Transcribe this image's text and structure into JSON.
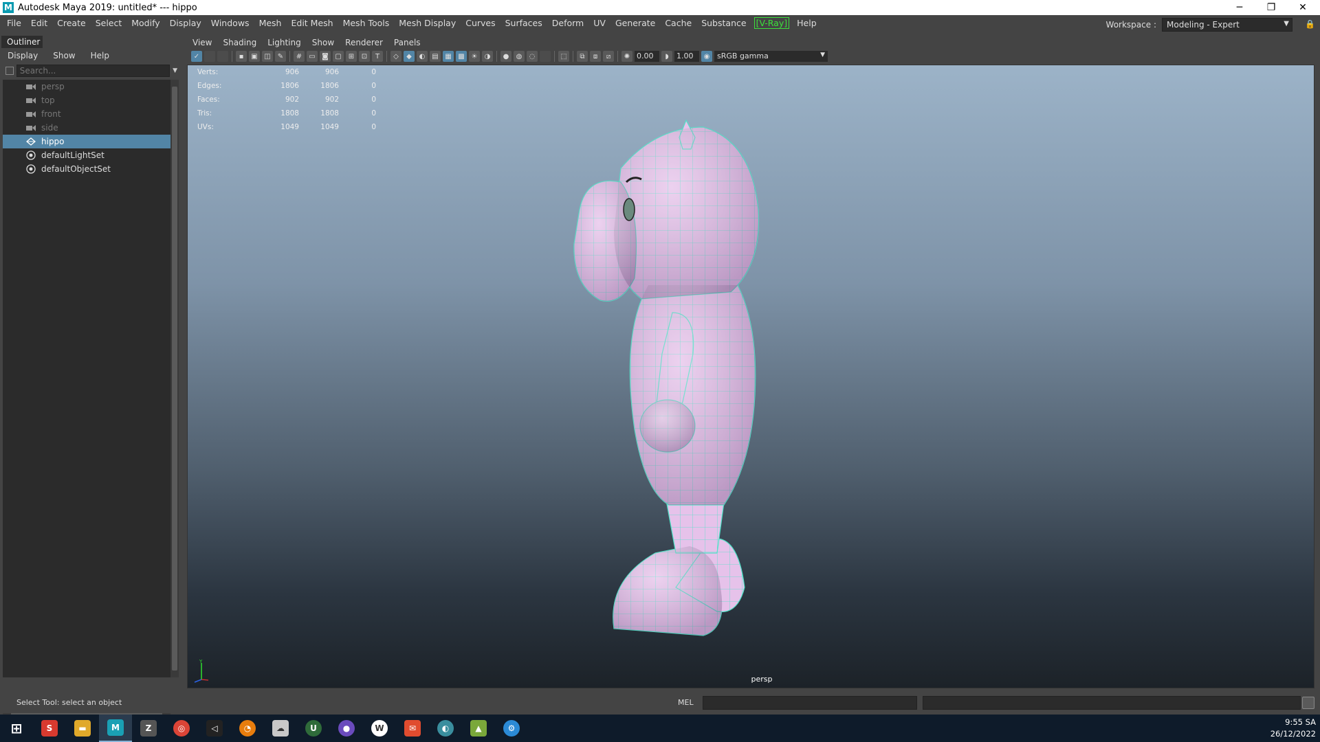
{
  "window": {
    "title": "Autodesk Maya 2019: untitled*   ---   hippo",
    "logo_letter": "M",
    "minimize": "─",
    "restore": "❐",
    "close": "✕"
  },
  "menubar": {
    "items": [
      "File",
      "Edit",
      "Create",
      "Select",
      "Modify",
      "Display",
      "Windows",
      "Mesh",
      "Edit Mesh",
      "Mesh Tools",
      "Mesh Display",
      "Curves",
      "Surfaces",
      "Deform",
      "UV",
      "Generate",
      "Cache",
      "Substance",
      "[V-Ray]",
      "Help"
    ],
    "workspace_label": "Workspace :",
    "workspace_value": "Modeling - Expert"
  },
  "outliner": {
    "tab": "Outliner",
    "menu": [
      "Display",
      "Show",
      "Help"
    ],
    "search_placeholder": "Search...",
    "items": [
      {
        "label": "persp",
        "icon": "camera-icon",
        "type": "camera"
      },
      {
        "label": "top",
        "icon": "camera-icon",
        "type": "camera"
      },
      {
        "label": "front",
        "icon": "camera-icon",
        "type": "camera"
      },
      {
        "label": "side",
        "icon": "camera-icon",
        "type": "camera"
      },
      {
        "label": "hippo",
        "icon": "mesh-icon",
        "type": "mesh",
        "selected": true
      },
      {
        "label": "defaultLightSet",
        "icon": "set-icon",
        "type": "set"
      },
      {
        "label": "defaultObjectSet",
        "icon": "set-icon",
        "type": "set"
      }
    ]
  },
  "viewport": {
    "menu": [
      "View",
      "Shading",
      "Lighting",
      "Show",
      "Renderer",
      "Panels"
    ],
    "exposure": "0.00",
    "gamma": "1.00",
    "color_space": "sRGB gamma",
    "camera": "persp",
    "hud": [
      {
        "label": "Verts:",
        "v1": "906",
        "v2": "906",
        "v3": "0"
      },
      {
        "label": "Edges:",
        "v1": "1806",
        "v2": "1806",
        "v3": "0"
      },
      {
        "label": "Faces:",
        "v1": "902",
        "v2": "902",
        "v3": "0"
      },
      {
        "label": "Tris:",
        "v1": "1808",
        "v2": "1808",
        "v3": "0"
      },
      {
        "label": "UVs:",
        "v1": "1049",
        "v2": "1049",
        "v3": "0"
      }
    ],
    "model_colors": {
      "surface": "#e8c4ec",
      "wire": "#4fe3c8"
    }
  },
  "status": {
    "help_line": "Select Tool: select an object",
    "mel_label": "MEL"
  },
  "taskbar": {
    "time": "9:55 SA",
    "date": "26/12/2022",
    "apps": [
      {
        "name": "windows-start-icon",
        "glyph": "⊞",
        "color": "#0e1b2a"
      },
      {
        "name": "sketchup-icon",
        "glyph": "S",
        "color": "#d83a2f"
      },
      {
        "name": "file-explorer-icon",
        "glyph": "▬",
        "color": "#e0a92a"
      },
      {
        "name": "maya-icon",
        "glyph": "M",
        "color": "#1aa0b4"
      },
      {
        "name": "zbrush-icon",
        "glyph": "Z",
        "color": "#555555"
      },
      {
        "name": "chrome-icon",
        "glyph": "◎",
        "color": "#db4437"
      },
      {
        "name": "unity-icon",
        "glyph": "◁",
        "color": "#222222"
      },
      {
        "name": "blender-icon",
        "glyph": "◔",
        "color": "#e87d0d"
      },
      {
        "name": "cloud-app-icon",
        "glyph": "☁",
        "color": "#c8c8c8"
      },
      {
        "name": "upwork-icon",
        "glyph": "U",
        "color": "#2f6b3a"
      },
      {
        "name": "github-icon",
        "glyph": "●",
        "color": "#6a4bbd"
      },
      {
        "name": "word-app-icon",
        "glyph": "W",
        "color": "#ffffff"
      },
      {
        "name": "messenger-icon",
        "glyph": "✉",
        "color": "#e04c2f"
      },
      {
        "name": "marmoset-icon",
        "glyph": "◐",
        "color": "#3a8e9e"
      },
      {
        "name": "photo-app-icon",
        "glyph": "▲",
        "color": "#7aa83a"
      },
      {
        "name": "settings-app-icon",
        "glyph": "⚙",
        "color": "#2b8ad6"
      }
    ]
  }
}
